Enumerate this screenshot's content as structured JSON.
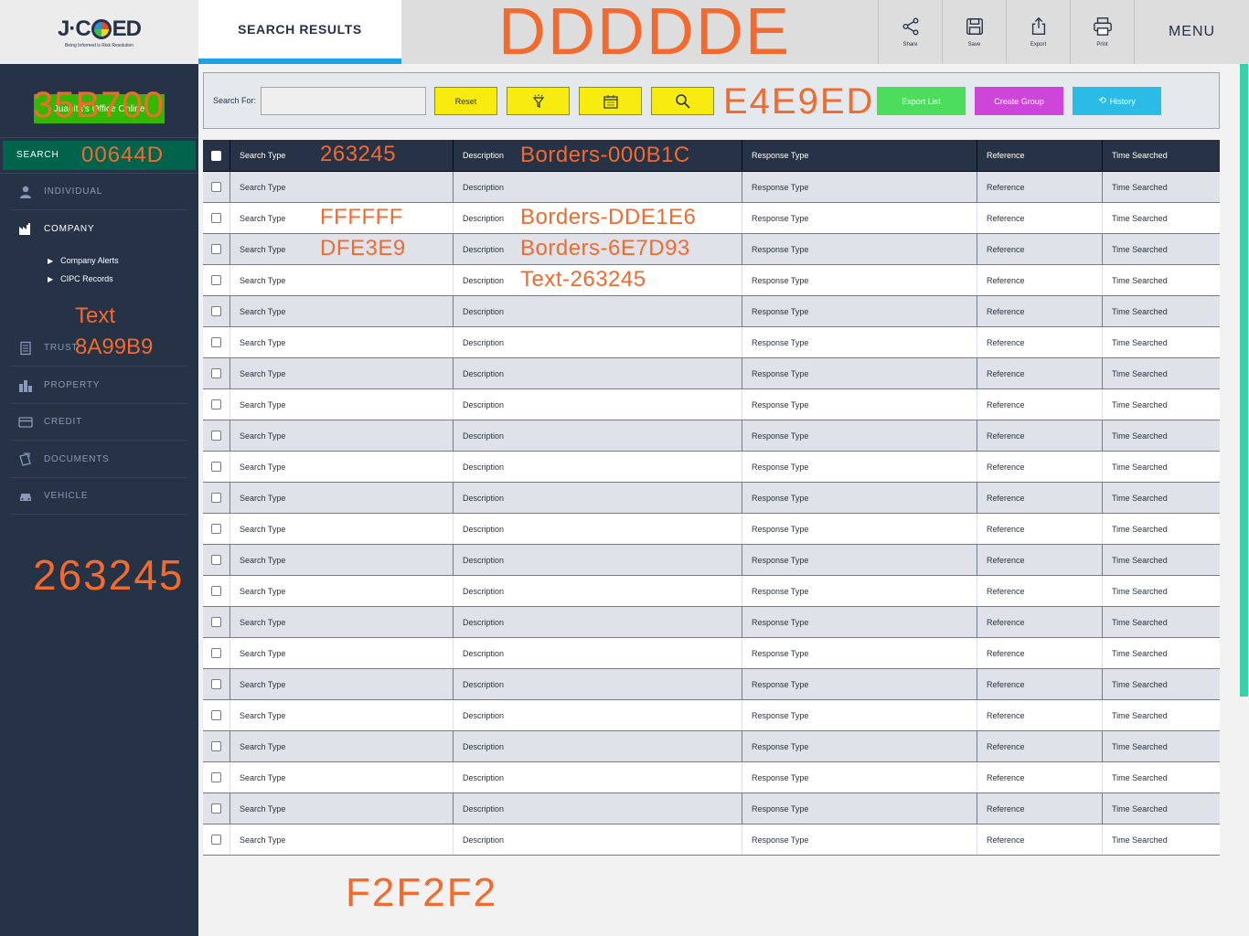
{
  "header": {
    "logo_text_left": "J·C",
    "logo_text_right": "ED",
    "logo_tagline": "Being Informed is Risk Resolution",
    "active_tab": "SEARCH RESULTS",
    "banner_color_code": "DDDDDE",
    "tools": [
      {
        "label": "Share",
        "icon": "share-icon"
      },
      {
        "label": "Save",
        "icon": "save-icon"
      },
      {
        "label": "Export",
        "icon": "export-icon"
      },
      {
        "label": "Print",
        "icon": "print-icon"
      }
    ],
    "menu_label": "MENU"
  },
  "sidebar": {
    "office_label": "Juanita's Office Online",
    "office_color_code": "35B700",
    "search_label": "SEARCH",
    "search_color_code": "00644D",
    "items": [
      {
        "label": "INDIVIDUAL",
        "icon": "person-icon"
      },
      {
        "label": "COMPANY",
        "icon": "factory-icon"
      },
      {
        "label": "TRUST",
        "icon": "document-icon"
      },
      {
        "label": "PROPERTY",
        "icon": "building-icon"
      },
      {
        "label": "CREDIT",
        "icon": "credit-card-icon"
      },
      {
        "label": "DOCUMENTS",
        "icon": "documents-icon"
      },
      {
        "label": "VEHICLE",
        "icon": "car-icon"
      }
    ],
    "sub_items": [
      "Company Alerts",
      "CIPC Records"
    ],
    "text_annotation": "Text",
    "trust_color_code": "8A99B9",
    "background_color_code": "263245"
  },
  "search_panel": {
    "label": "Search For:",
    "input_value": "",
    "reset_label": "Reset",
    "panel_color_code": "E4E9ED",
    "export_list_label": "Export List",
    "create_group_label": "Create Group",
    "history_label": "History"
  },
  "table": {
    "columns": [
      "Search Type",
      "Description",
      "Response Type",
      "Reference",
      "Time Searched"
    ],
    "rows": [
      [
        "Search Type",
        "Description",
        "Response Type",
        "Reference",
        "Time Searched"
      ],
      [
        "Search Type",
        "Description",
        "Response Type",
        "Reference",
        "Time Searched"
      ],
      [
        "Search Type",
        "Description",
        "Response Type",
        "Reference",
        "Time Searched"
      ],
      [
        "Search Type",
        "Description",
        "Response Type",
        "Reference",
        "Time Searched"
      ],
      [
        "Search Type",
        "Description",
        "Response Type",
        "Reference",
        "Time Searched"
      ],
      [
        "Search Type",
        "Description",
        "Response Type",
        "Reference",
        "Time Searched"
      ],
      [
        "Search Type",
        "Description",
        "Response Type",
        "Reference",
        "Time Searched"
      ],
      [
        "Search Type",
        "Description",
        "Response Type",
        "Reference",
        "Time Searched"
      ],
      [
        "Search Type",
        "Description",
        "Response Type",
        "Reference",
        "Time Searched"
      ],
      [
        "Search Type",
        "Description",
        "Response Type",
        "Reference",
        "Time Searched"
      ],
      [
        "Search Type",
        "Description",
        "Response Type",
        "Reference",
        "Time Searched"
      ],
      [
        "Search Type",
        "Description",
        "Response Type",
        "Reference",
        "Time Searched"
      ],
      [
        "Search Type",
        "Description",
        "Response Type",
        "Reference",
        "Time Searched"
      ],
      [
        "Search Type",
        "Description",
        "Response Type",
        "Reference",
        "Time Searched"
      ],
      [
        "Search Type",
        "Description",
        "Response Type",
        "Reference",
        "Time Searched"
      ],
      [
        "Search Type",
        "Description",
        "Response Type",
        "Reference",
        "Time Searched"
      ],
      [
        "Search Type",
        "Description",
        "Response Type",
        "Reference",
        "Time Searched"
      ],
      [
        "Search Type",
        "Description",
        "Response Type",
        "Reference",
        "Time Searched"
      ],
      [
        "Search Type",
        "Description",
        "Response Type",
        "Reference",
        "Time Searched"
      ],
      [
        "Search Type",
        "Description",
        "Response Type",
        "Reference",
        "Time Searched"
      ],
      [
        "Search Type",
        "Description",
        "Response Type",
        "Reference",
        "Time Searched"
      ],
      [
        "Search Type",
        "Description",
        "Response Type",
        "Reference",
        "Time Searched"
      ]
    ],
    "annotations": {
      "header_bg": "263245",
      "header_border": "Borders-000B1C",
      "row_white": "FFFFFF",
      "row_white_border": "Borders-DDE1E6",
      "row_grey": "DFE3E9",
      "row_grey_border": "Borders-6E7D93",
      "text_color": "Text-263245"
    }
  },
  "page": {
    "bottom_color_code": "F2F2F2"
  },
  "colors": {
    "annotation": "#F26A2E",
    "accent_blue": "#1BA1E8",
    "yellow_button": "#F8EB10",
    "export_green": "#4CDD5E",
    "create_group_magenta": "#CD45D9",
    "history_cyan": "#2ABCE6",
    "scroll_thumb": "#3AD0A8"
  }
}
